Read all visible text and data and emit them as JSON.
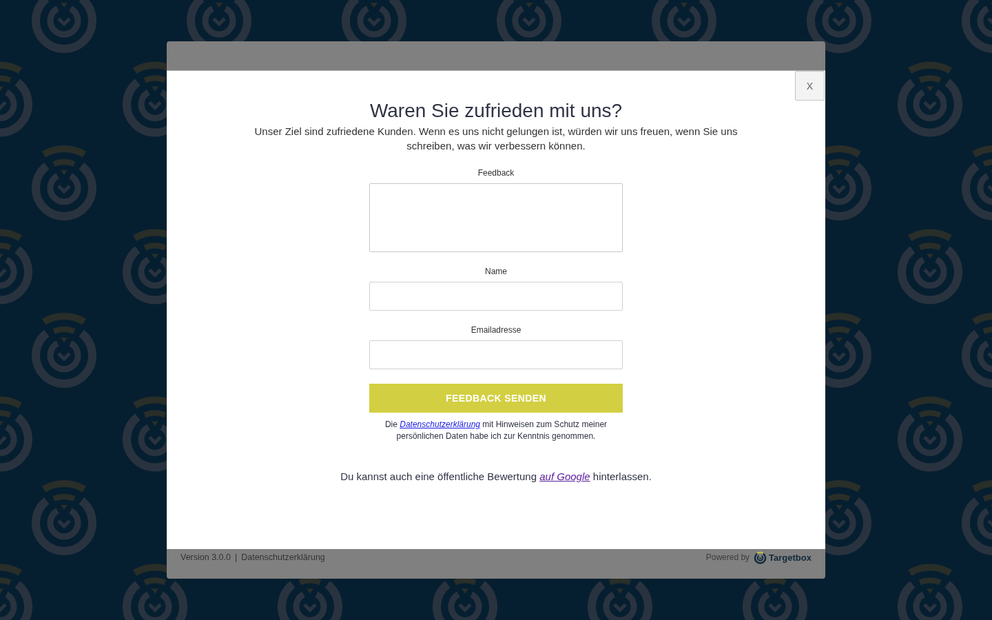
{
  "dialog": {
    "close_button": "x",
    "title": "Waren Sie zufrieden mit uns?",
    "intro": "Unser Ziel sind zufriedene Kunden. Wenn es uns nicht gelungen ist, würden wir uns freuen, wenn Sie uns schreiben, was wir verbessern können.",
    "fields": [
      {
        "kind": "textarea",
        "label": "Feedback"
      },
      {
        "kind": "input",
        "label": "Name"
      },
      {
        "kind": "input",
        "label": "Emailadresse"
      }
    ],
    "submit_button": "FEEDBACK SENDEN",
    "privacy_note": {
      "before": "Die",
      "link": {
        "text": "Datenschutzerklärung",
        "visited": false
      },
      "after": "mit Hinweisen zum Schutz meiner persönlichen Daten habe ich zur Kenntnis genommen."
    },
    "review_note": {
      "before": "Du kannst auch eine öffentliche Bewertung",
      "link": {
        "text": "auf Google",
        "visited": true
      },
      "after": "hinterlassen."
    }
  },
  "footer": {
    "version": "Version 3.0.0",
    "separator": "|",
    "privacy_link": "Datenschutzerklärung",
    "powered_by": "Powered by",
    "brand": "Targetbox"
  }
}
